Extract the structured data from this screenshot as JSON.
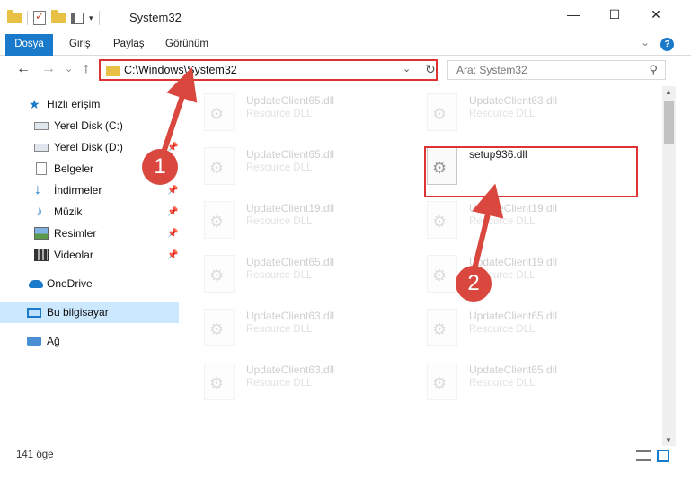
{
  "window": {
    "title": "System32",
    "minimize_glyph": "—",
    "maximize_glyph": "☐",
    "close_glyph": "✕"
  },
  "ribbon": {
    "tabs": [
      "Dosya",
      "Giriş",
      "Paylaş",
      "Görünüm"
    ],
    "help_glyph": "?"
  },
  "navigation": {
    "back_glyph": "←",
    "forward_glyph": "→",
    "recent_glyph": "⌄",
    "up_glyph": "↑",
    "address": "C:\\Windows\\System32",
    "search_placeholder": "Ara: System32"
  },
  "sidebar": {
    "items": [
      {
        "label": "Hızlı erişim",
        "icon": "star-icon"
      },
      {
        "label": "Yerel Disk (C:)",
        "icon": "disk-icon"
      },
      {
        "label": "Yerel Disk (D:)",
        "icon": "disk-icon"
      },
      {
        "label": "Belgeler",
        "icon": "documents-icon"
      },
      {
        "label": "İndirmeler",
        "icon": "download-icon"
      },
      {
        "label": "Müzik",
        "icon": "music-icon"
      },
      {
        "label": "Resimler",
        "icon": "pictures-icon"
      },
      {
        "label": "Videolar",
        "icon": "videos-icon"
      },
      {
        "label": "OneDrive",
        "icon": "cloud-icon"
      },
      {
        "label": "Bu bilgisayar",
        "icon": "computer-icon"
      },
      {
        "label": "Ağ",
        "icon": "network-icon"
      }
    ]
  },
  "files": [
    {
      "name": "UpdateClient65.dll",
      "type": "Resource DLL",
      "faded": true
    },
    {
      "name": "UpdateClient63.dll",
      "type": "Resource DLL",
      "faded": true
    },
    {
      "name": "UpdateClient65.dll",
      "type": "Resource DLL",
      "faded": true
    },
    {
      "name": "setup936.dll",
      "type": "",
      "faded": false
    },
    {
      "name": "UpdateClient19.dll",
      "type": "Resource DLL",
      "faded": true
    },
    {
      "name": "UpdateClient19.dll",
      "type": "Resource DLL",
      "faded": true
    },
    {
      "name": "UpdateClient65.dll",
      "type": "Resource DLL",
      "faded": true
    },
    {
      "name": "UpdateClient19.dll",
      "type": "Resource DLL",
      "faded": true
    },
    {
      "name": "UpdateClient63.dll",
      "type": "Resource DLL",
      "faded": true
    },
    {
      "name": "UpdateClient65.dll",
      "type": "Resource DLL",
      "faded": true
    },
    {
      "name": "UpdateClient63.dll",
      "type": "Resource DLL",
      "faded": true
    },
    {
      "name": "UpdateClient65.dll",
      "type": "Resource DLL",
      "faded": true
    }
  ],
  "status": {
    "item_count": "141 öge"
  },
  "annotations": {
    "step1": "1",
    "step2": "2",
    "color": "#d9473f"
  }
}
